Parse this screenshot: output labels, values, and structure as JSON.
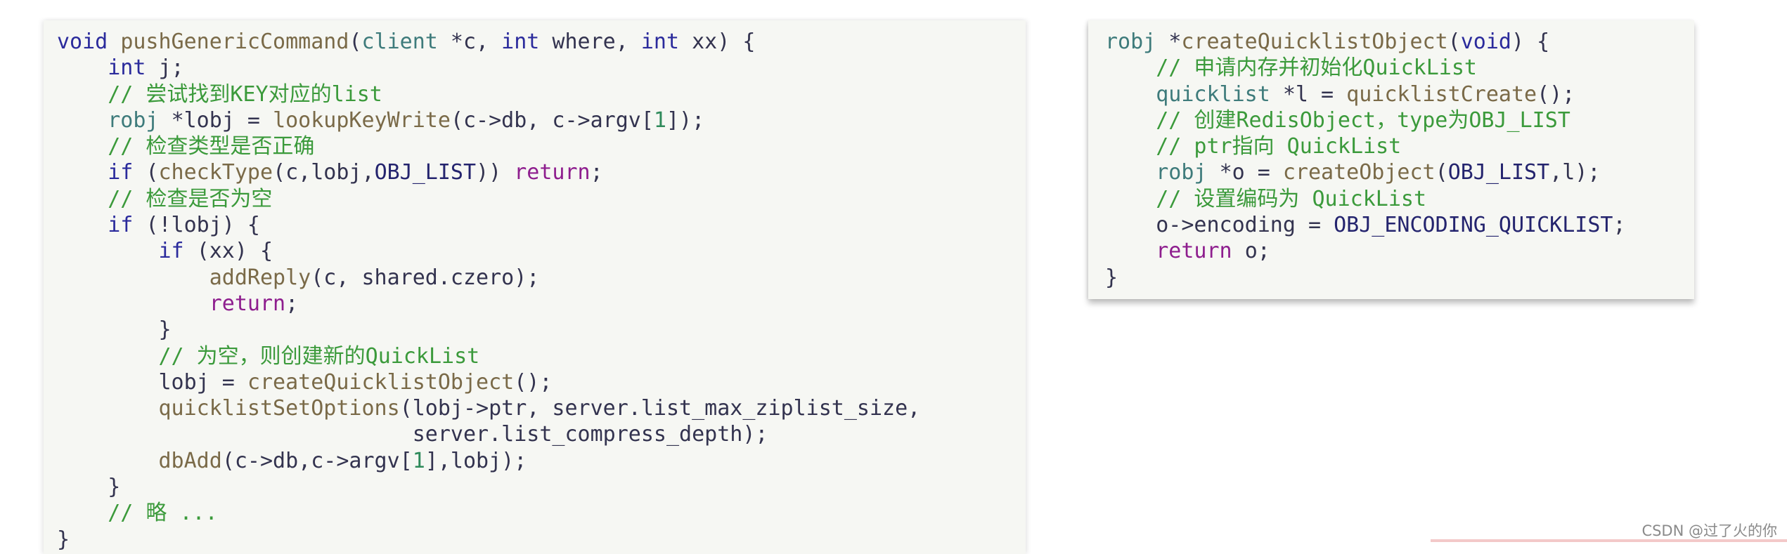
{
  "colors": {
    "panel_bg": "#f6f7f3",
    "keyword": "#2b2b9c",
    "return_keyword": "#8e1e8e",
    "comment": "#3b9a3b",
    "function": "#7a6a48",
    "type": "#3e7b7b",
    "constant": "#24246e",
    "number": "#2e8a5a"
  },
  "left_code": [
    [
      [
        "kw",
        "void "
      ],
      [
        "fn",
        "pushGenericCommand"
      ],
      [
        "pl",
        "("
      ],
      [
        "ty",
        "client "
      ],
      [
        "pl",
        "*c, "
      ],
      [
        "kw",
        "int "
      ],
      [
        "pl",
        "where, "
      ],
      [
        "kw",
        "int "
      ],
      [
        "pl",
        "xx) {"
      ]
    ],
    [
      [
        "pl",
        "    "
      ],
      [
        "kw",
        "int "
      ],
      [
        "pl",
        "j;"
      ]
    ],
    [
      [
        "cm",
        "    // 尝试找到KEY对应的list"
      ]
    ],
    [
      [
        "pl",
        "    "
      ],
      [
        "ty",
        "robj "
      ],
      [
        "pl",
        "*lobj = "
      ],
      [
        "fn",
        "lookupKeyWrite"
      ],
      [
        "pl",
        "(c->db, c->argv["
      ],
      [
        "num",
        "1"
      ],
      [
        "pl",
        "]);"
      ]
    ],
    [
      [
        "cm",
        "    // 检查类型是否正确"
      ]
    ],
    [
      [
        "pl",
        "    "
      ],
      [
        "kw",
        "if "
      ],
      [
        "pl",
        "("
      ],
      [
        "fn",
        "checkType"
      ],
      [
        "pl",
        "(c,lobj,"
      ],
      [
        "cn",
        "OBJ_LIST"
      ],
      [
        "pl",
        ")) "
      ],
      [
        "ret",
        "return"
      ],
      [
        "pl",
        ";"
      ]
    ],
    [
      [
        "cm",
        "    // 检查是否为空"
      ]
    ],
    [
      [
        "pl",
        "    "
      ],
      [
        "kw",
        "if "
      ],
      [
        "pl",
        "(!lobj) {"
      ]
    ],
    [
      [
        "pl",
        "        "
      ],
      [
        "kw",
        "if "
      ],
      [
        "pl",
        "(xx) {"
      ]
    ],
    [
      [
        "pl",
        "            "
      ],
      [
        "fn",
        "addReply"
      ],
      [
        "pl",
        "(c, shared.czero);"
      ]
    ],
    [
      [
        "pl",
        "            "
      ],
      [
        "ret",
        "return"
      ],
      [
        "pl",
        ";"
      ]
    ],
    [
      [
        "pl",
        "        }"
      ]
    ],
    [
      [
        "cm",
        "        // 为空，则创建新的QuickList"
      ]
    ],
    [
      [
        "pl",
        "        lobj = "
      ],
      [
        "fn",
        "createQuicklistObject"
      ],
      [
        "pl",
        "();"
      ]
    ],
    [
      [
        "pl",
        "        "
      ],
      [
        "fn",
        "quicklistSetOptions"
      ],
      [
        "pl",
        "(lobj->ptr, server.list_max_ziplist_size,"
      ]
    ],
    [
      [
        "pl",
        "                            server.list_compress_depth);"
      ]
    ],
    [
      [
        "pl",
        "        "
      ],
      [
        "fn",
        "dbAdd"
      ],
      [
        "pl",
        "(c->db,c->argv["
      ],
      [
        "num",
        "1"
      ],
      [
        "pl",
        "],lobj);"
      ]
    ],
    [
      [
        "pl",
        "    }"
      ]
    ],
    [
      [
        "cm",
        "    // 略 ..."
      ]
    ],
    [
      [
        "pl",
        "}"
      ]
    ]
  ],
  "right_code": [
    [
      [
        "ty",
        "robj "
      ],
      [
        "pl",
        "*"
      ],
      [
        "fn",
        "createQuicklistObject"
      ],
      [
        "pl",
        "("
      ],
      [
        "kw",
        "void"
      ],
      [
        "pl",
        ") {"
      ]
    ],
    [
      [
        "cm",
        "    // 申请内存并初始化QuickList"
      ]
    ],
    [
      [
        "pl",
        "    "
      ],
      [
        "ty",
        "quicklist "
      ],
      [
        "pl",
        "*l = "
      ],
      [
        "fn",
        "quicklistCreate"
      ],
      [
        "pl",
        "();"
      ]
    ],
    [
      [
        "cm",
        "    // 创建RedisObject，type为OBJ_LIST"
      ]
    ],
    [
      [
        "cm",
        "    // ptr指向 QuickList"
      ]
    ],
    [
      [
        "pl",
        "    "
      ],
      [
        "ty",
        "robj "
      ],
      [
        "pl",
        "*o = "
      ],
      [
        "fn",
        "createObject"
      ],
      [
        "pl",
        "("
      ],
      [
        "cn",
        "OBJ_LIST"
      ],
      [
        "pl",
        ",l);"
      ]
    ],
    [
      [
        "cm",
        "    // 设置编码为 QuickList"
      ]
    ],
    [
      [
        "pl",
        "    o->encoding = "
      ],
      [
        "cn",
        "OBJ_ENCODING_QUICKLIST"
      ],
      [
        "pl",
        ";"
      ]
    ],
    [
      [
        "pl",
        "    "
      ],
      [
        "ret",
        "return "
      ],
      [
        "pl",
        "o;"
      ]
    ],
    [
      [
        "pl",
        "}"
      ]
    ]
  ],
  "watermark": "CSDN @过了火的你"
}
